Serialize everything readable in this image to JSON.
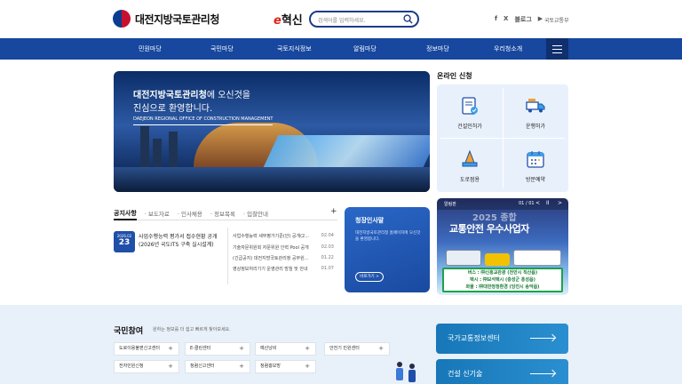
{
  "header": {
    "logo_text": "대전지방국토관리청",
    "reform_label_e": "e",
    "reform_label": "혁신",
    "search_placeholder": "검색어를 입력하세요.",
    "sns": [
      "f",
      "X",
      "블로그",
      "▶"
    ],
    "lang_link": "국토교통부"
  },
  "nav": {
    "items": [
      "민원마당",
      "국민마당",
      "국토지식정보",
      "알림마당",
      "정보마당",
      "우리청소개"
    ]
  },
  "hero": {
    "title_bold": "대전지방국토관리청",
    "title_rest": "에 오신것을",
    "title_line2": "진심으로 환영합니다.",
    "subtitle": "DAEJEON REGIONAL OFFICE OF CONSTRUCTION MANAGEMENT"
  },
  "online": {
    "title": "온라인 신청",
    "items": [
      {
        "label": "건설인허가",
        "icon": "document-check-icon"
      },
      {
        "label": "운행허가",
        "icon": "truck-icon"
      },
      {
        "label": "도로점용",
        "icon": "road-cone-icon"
      },
      {
        "label": "방문예약",
        "icon": "calendar-icon"
      }
    ]
  },
  "notices": {
    "tabs": [
      "공지사항",
      "보도자료",
      "인사채용",
      "정보목록",
      "입찰안내"
    ],
    "plus": "+",
    "feature": {
      "date_top": "2026.02",
      "date_day": "23",
      "text": "사업수행능력 평가서 접수현황 공개(2026년 국도ITS 구축 실시설계)"
    },
    "items": [
      {
        "title": "사업수행능력 세부평가기준(안) 공개(2...",
        "date": "02.04"
      },
      {
        "title": "기술자문위원회 자문위원 인력 Pool 공개",
        "date": "02.03"
      },
      {
        "title": "(긴급공지) 대전지방국토관리청 공무원...",
        "date": "01.22"
      },
      {
        "title": "영상정보처리기기 운영관리 방침 및 안내",
        "date": "01.07"
      }
    ]
  },
  "petition": {
    "title": "청장인사말",
    "desc": "대전지방국토관리청 홈페이지에 오신것을 환영합니다.",
    "button": "바로가기 >"
  },
  "alert": {
    "label": "알림판",
    "page": "01 / 01",
    "prev": "<",
    "pause": "II",
    "next": ">",
    "year": "2025 종합",
    "title": "교통안전 우수사업자",
    "lines": [
      "버스 : ㈜신흥교관광 (천안시 직산읍)",
      "택시 : ㈜보석택시 (충성군 홍성읍)",
      "화물 : ㈜대한청정환경 (당진시 송악읍)"
    ]
  },
  "participation": {
    "title": "국민참여",
    "subtitle": "원하는 정보를 더 쉽고 빠르게 찾아보세요.",
    "buttons": [
      "도로이용불편신고센터",
      "E-클린센터",
      "예산낭비",
      "안전기 민원센터",
      "전자민원신청",
      "청렴신고센터",
      "청렴홍보방"
    ]
  },
  "side_links": [
    "국가교통정보센터",
    "건설 신기술"
  ],
  "colors": {
    "nav_bg": "#17479e",
    "accent_blue": "#1f4fa8",
    "bottom_bg": "#e8f0f9"
  }
}
